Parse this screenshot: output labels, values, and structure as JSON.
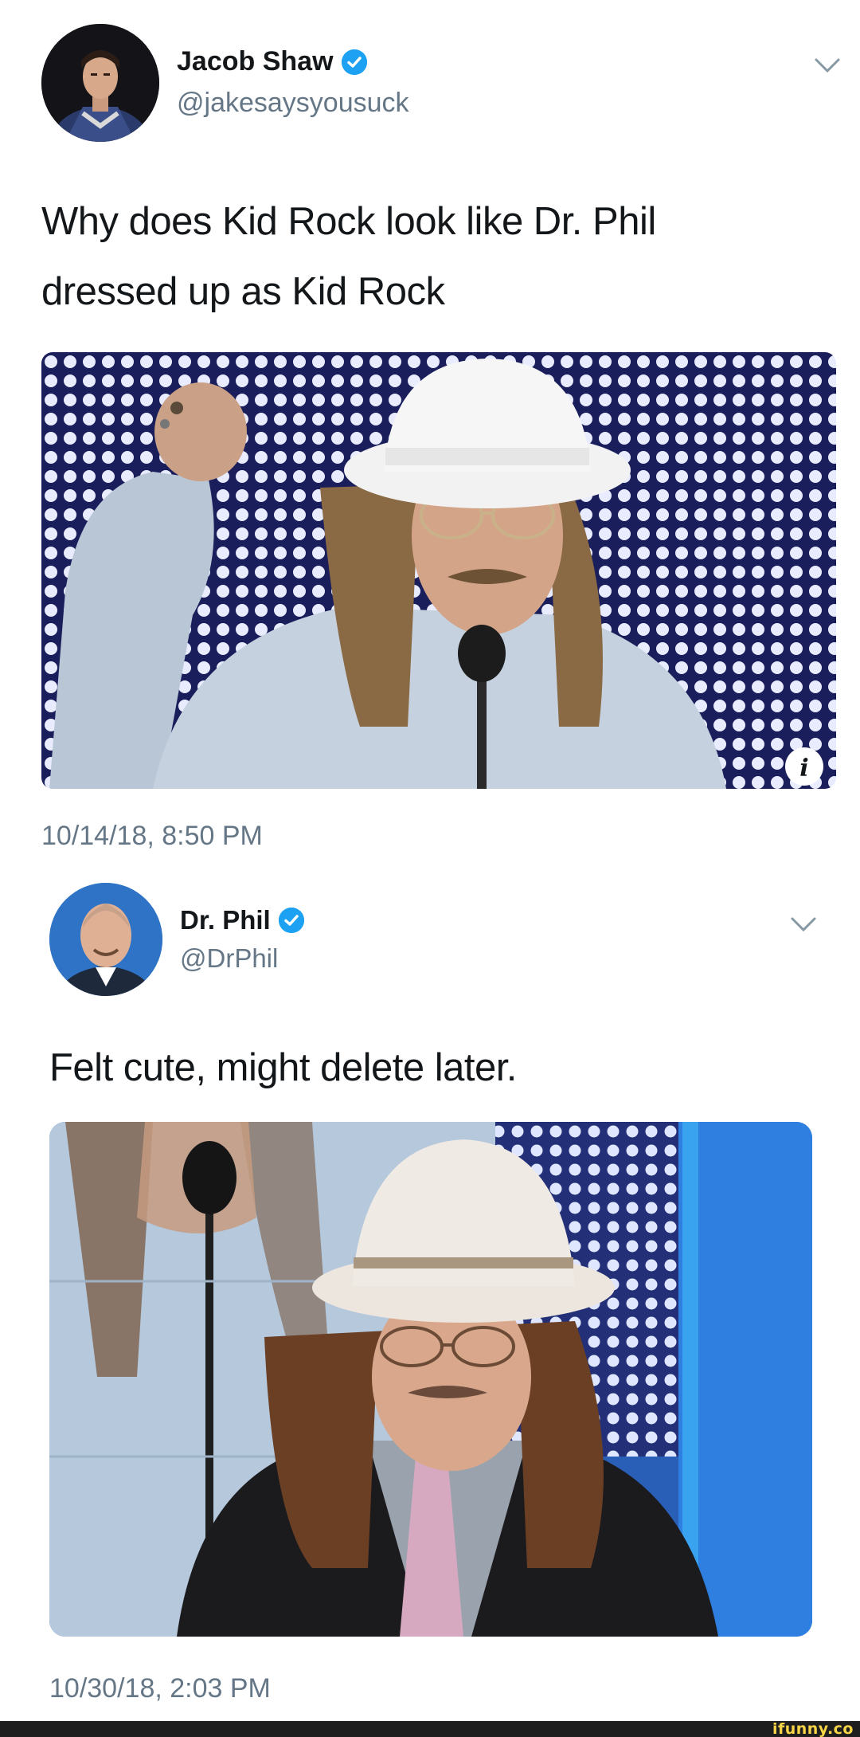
{
  "tweets": [
    {
      "display_name": "Jacob Shaw",
      "handle": "@jakesaysyousuck",
      "text_line1": "Why does Kid Rock look like Dr. Phil",
      "text_line2": "dressed up as Kid Rock",
      "timestamp": "10/14/18, 8:50 PM",
      "verified": true
    },
    {
      "display_name": "Dr. Phil",
      "handle": "@DrPhil",
      "text_line1": "Felt cute, might delete later.",
      "timestamp": "10/30/18, 2:03 PM",
      "verified": true
    }
  ],
  "footer": {
    "brand": "ifunny.co"
  },
  "colors": {
    "verified_blue": "#1da1f2",
    "secondary_text": "#657786",
    "primary_text": "#14171a",
    "led_panel": "#1a1f5c",
    "brand_yellow": "#f7d547"
  },
  "icons": [
    "verified-badge-icon",
    "chevron-down-icon",
    "info-icon"
  ]
}
